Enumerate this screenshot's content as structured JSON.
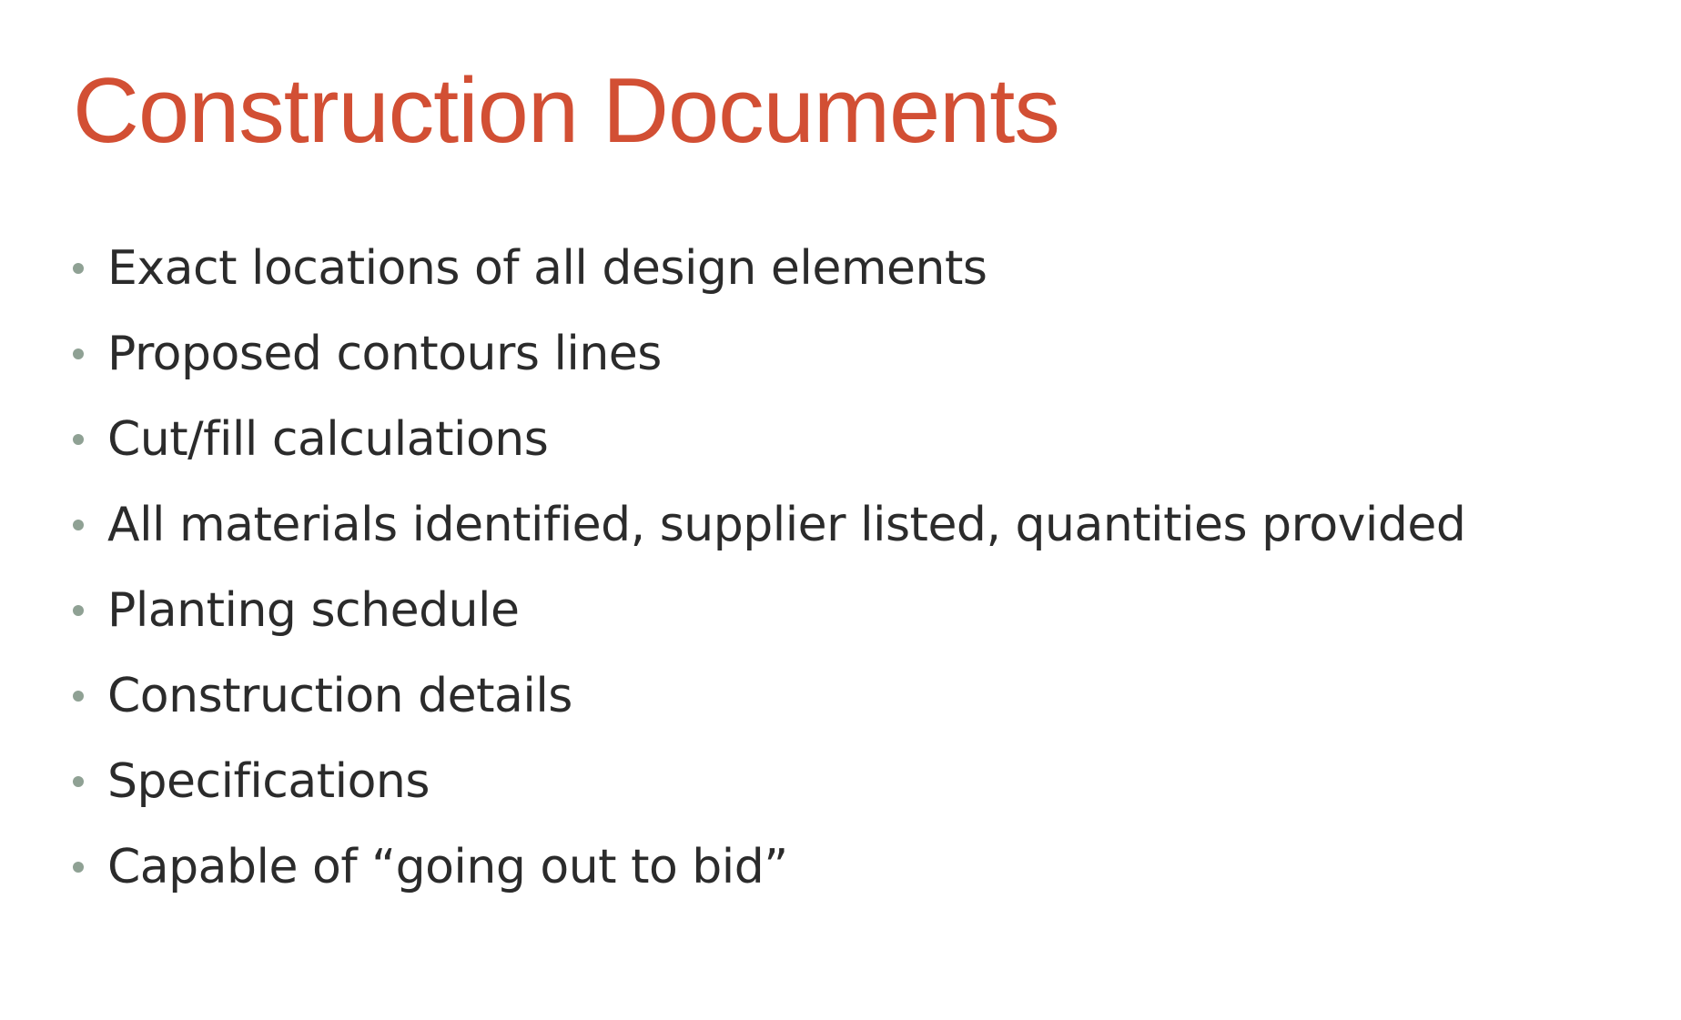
{
  "colors": {
    "background": "#ffffff",
    "title": "#d24f34",
    "text": "#2b2b2b",
    "bullet": "#8fa194"
  },
  "slide": {
    "title": "Construction Documents",
    "bullets": [
      "Exact locations of all design elements",
      "Proposed contours lines",
      "Cut/fill calculations",
      "All materials identified, supplier listed, quantities provided",
      "Planting schedule",
      "Construction details",
      "Specifications",
      "Capable of “going out to bid”"
    ]
  }
}
